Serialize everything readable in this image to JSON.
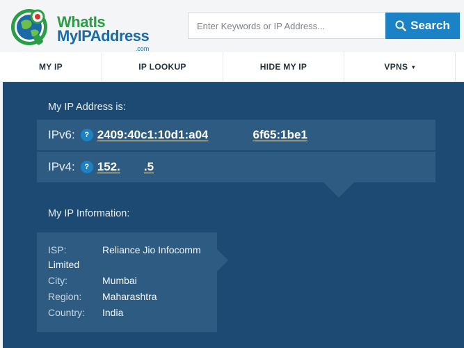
{
  "logo": {
    "line1": "WhatIs",
    "line2": "MyIPAddress",
    "line3": ".com"
  },
  "search": {
    "placeholder": "Enter Keywords or IP Address...",
    "button_label": "Search"
  },
  "nav": {
    "items": [
      "MY IP",
      "IP LOOKUP",
      "HIDE MY IP",
      "VPNS"
    ],
    "vpns_caret": "▾"
  },
  "ip_section": {
    "heading": "My IP Address is:",
    "ipv6_label": "IPv6:",
    "ipv6_value_start": "2409:40c1:10d1:a04",
    "ipv6_value_end": "6f65:1be1",
    "ipv4_label": "IPv4:",
    "ipv4_value_start": "152.",
    "ipv4_value_end": ".5",
    "help_glyph": "?"
  },
  "info_section": {
    "heading": "My IP Information:",
    "isp_key": "ISP:",
    "isp_value_line1": "Reliance Jio Infocomm",
    "isp_value_line2": "Limited",
    "city_key": "City:",
    "city_value": "Mumbai",
    "region_key": "Region:",
    "region_value": "Maharashtra",
    "country_key": "Country:",
    "country_value": "India"
  },
  "colors": {
    "brand_green": "#2a9d46",
    "brand_blue": "#1a6aa5",
    "accent": "#1a82c5",
    "panel_bg": "#1c4a72",
    "row_bg": "#2d5b82"
  },
  "icons": {
    "search": "search-icon",
    "logo": "globe-magnifier-icon",
    "help": "question-icon",
    "caret": "caret-down-icon"
  }
}
